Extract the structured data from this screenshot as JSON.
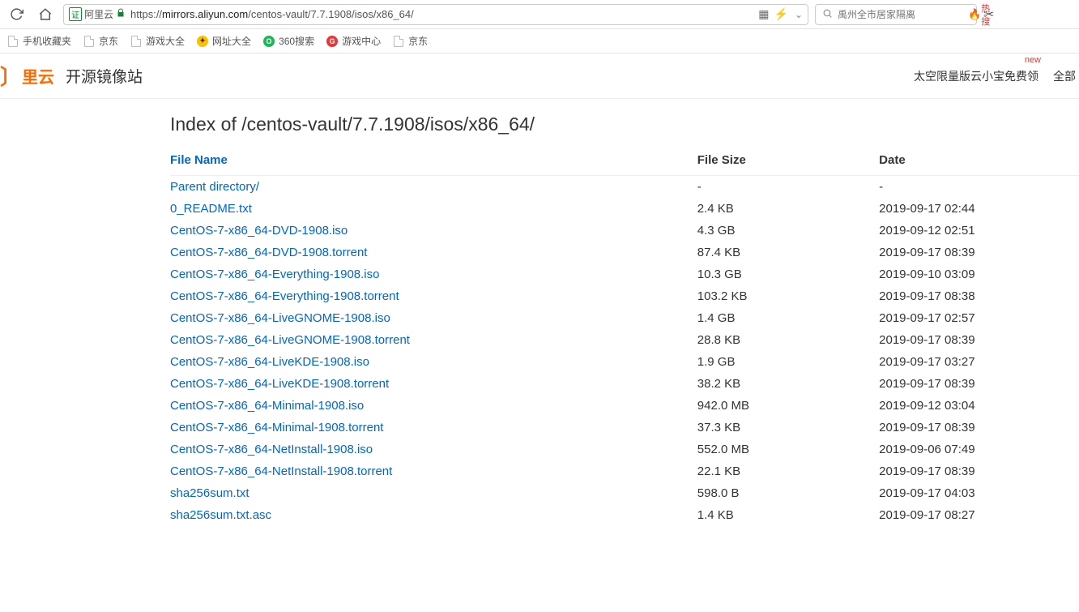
{
  "browser": {
    "site_label": "阿里云",
    "cert_label": "证",
    "url_scheme": "https",
    "url_host": "mirrors.aliyun.com",
    "url_path": "/centos-vault/7.7.1908/isos/x86_64/",
    "search_placeholder": "禹州全市居家隔离",
    "hot_label": "热搜"
  },
  "bookmarks": [
    {
      "label": "手机收藏夹",
      "icon": "page"
    },
    {
      "label": "京东",
      "icon": "page"
    },
    {
      "label": "游戏大全",
      "icon": "page"
    },
    {
      "label": "网址大全",
      "icon": "360wz"
    },
    {
      "label": "360搜索",
      "icon": "360s"
    },
    {
      "label": "游戏中心",
      "icon": "gc"
    },
    {
      "label": "京东",
      "icon": "page"
    }
  ],
  "header": {
    "logo_text": "里云",
    "site_title": "开源镜像站",
    "promo_label": "太空限量版云小宝免费领",
    "promo_tag": "new",
    "all_label": "全部"
  },
  "listing": {
    "title": "Index of /centos-vault/7.7.1908/isos/x86_64/",
    "columns": {
      "name": "File Name",
      "size": "File Size",
      "date": "Date"
    },
    "rows": [
      {
        "name": "Parent directory/",
        "size": "-",
        "date": "-"
      },
      {
        "name": "0_README.txt",
        "size": "2.4 KB",
        "date": "2019-09-17 02:44"
      },
      {
        "name": "CentOS-7-x86_64-DVD-1908.iso",
        "size": "4.3 GB",
        "date": "2019-09-12 02:51"
      },
      {
        "name": "CentOS-7-x86_64-DVD-1908.torrent",
        "size": "87.4 KB",
        "date": "2019-09-17 08:39"
      },
      {
        "name": "CentOS-7-x86_64-Everything-1908.iso",
        "size": "10.3 GB",
        "date": "2019-09-10 03:09"
      },
      {
        "name": "CentOS-7-x86_64-Everything-1908.torrent",
        "size": "103.2 KB",
        "date": "2019-09-17 08:38"
      },
      {
        "name": "CentOS-7-x86_64-LiveGNOME-1908.iso",
        "size": "1.4 GB",
        "date": "2019-09-17 02:57"
      },
      {
        "name": "CentOS-7-x86_64-LiveGNOME-1908.torrent",
        "size": "28.8 KB",
        "date": "2019-09-17 08:39"
      },
      {
        "name": "CentOS-7-x86_64-LiveKDE-1908.iso",
        "size": "1.9 GB",
        "date": "2019-09-17 03:27"
      },
      {
        "name": "CentOS-7-x86_64-LiveKDE-1908.torrent",
        "size": "38.2 KB",
        "date": "2019-09-17 08:39"
      },
      {
        "name": "CentOS-7-x86_64-Minimal-1908.iso",
        "size": "942.0 MB",
        "date": "2019-09-12 03:04"
      },
      {
        "name": "CentOS-7-x86_64-Minimal-1908.torrent",
        "size": "37.3 KB",
        "date": "2019-09-17 08:39"
      },
      {
        "name": "CentOS-7-x86_64-NetInstall-1908.iso",
        "size": "552.0 MB",
        "date": "2019-09-06 07:49"
      },
      {
        "name": "CentOS-7-x86_64-NetInstall-1908.torrent",
        "size": "22.1 KB",
        "date": "2019-09-17 08:39"
      },
      {
        "name": "sha256sum.txt",
        "size": "598.0 B",
        "date": "2019-09-17 04:03"
      },
      {
        "name": "sha256sum.txt.asc",
        "size": "1.4 KB",
        "date": "2019-09-17 08:27"
      }
    ]
  }
}
